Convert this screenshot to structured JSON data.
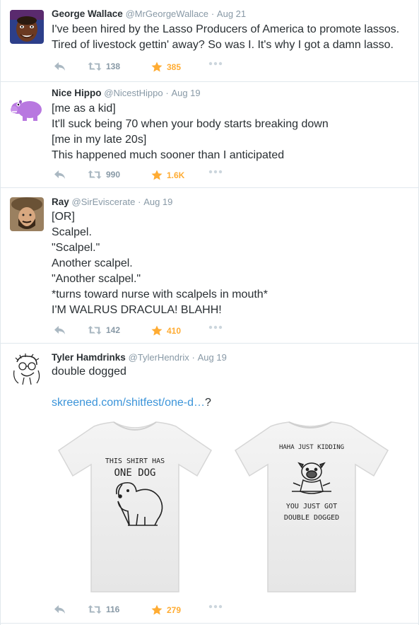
{
  "tweets": [
    {
      "name": "George Wallace",
      "handle": "@MrGeorgeWallace",
      "time": "Aug 21",
      "lines": [
        "I've been hired by the Lasso Producers of America to promote lassos.",
        "Tired of livestock gettin' away? So was I. It's why I got a damn lasso."
      ],
      "retweets": "138",
      "favorites": "385"
    },
    {
      "name": "Nice Hippo",
      "handle": "@NicestHippo",
      "time": "Aug 19",
      "lines": [
        "[me as a kid]",
        "It'll suck being 70 when your body starts breaking down",
        "[me in my late 20s]",
        "This happened much sooner than I anticipated"
      ],
      "retweets": "990",
      "favorites": "1.6K"
    },
    {
      "name": "Ray",
      "handle": "@SirEviscerate",
      "time": "Aug 19",
      "lines": [
        "[OR]",
        "Scalpel.",
        "\"Scalpel.\"",
        "Another scalpel.",
        "\"Another scalpel.\"",
        "*turns toward nurse with scalpels in mouth*",
        "I'M WALRUS DRACULA! BLAHH!"
      ],
      "retweets": "142",
      "favorites": "410"
    },
    {
      "name": "Tyler Hamdrinks",
      "handle": "@TylerHendrix",
      "time": "Aug 19",
      "lines": [
        "double dogged"
      ],
      "link": "skreened.com/shitfest/one-d…",
      "link_suffix": "?",
      "retweets": "116",
      "favorites": "279",
      "media": {
        "shirt1": [
          "THIS SHIRT HAS",
          "ONE DOG"
        ],
        "shirt2": [
          "HAHA JUST KIDDING",
          "YOU JUST GOT",
          "DOUBLE DOGGED"
        ]
      }
    }
  ],
  "colors": {
    "name": "#292f33",
    "meta": "#8899a6",
    "link": "#3b94d9",
    "favorite": "#ffac33",
    "divider": "#e1e8ed"
  },
  "icons": [
    "reply-icon",
    "retweet-icon",
    "favorite-star-icon",
    "more-dots-icon"
  ]
}
